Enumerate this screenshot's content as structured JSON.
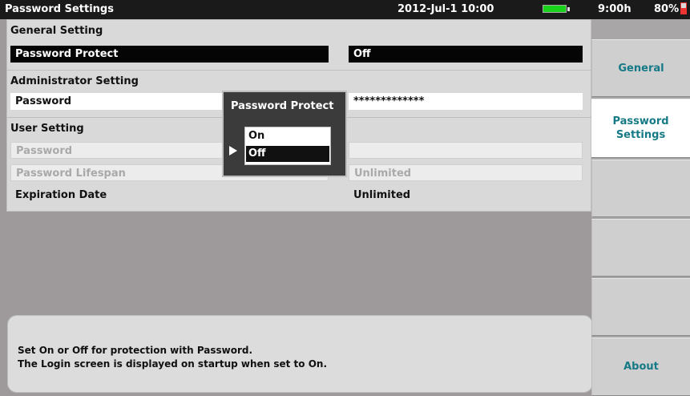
{
  "title_bar": {
    "title": "Password Settings",
    "datetime": "2012-Jul-1 10:00",
    "power_color": "#19d21a"
  },
  "status": {
    "time": "9:00h",
    "battery_percent": "80%"
  },
  "general": {
    "heading": "General Setting",
    "password_protect_label": "Password Protect",
    "password_protect_value": "Off"
  },
  "admin": {
    "heading": "Administrator Setting",
    "password_label": "Password",
    "password_value": "*************"
  },
  "user": {
    "heading": "User Setting",
    "password_label": "Password",
    "password_value": "",
    "lifespan_label": "Password Lifespan",
    "lifespan_value": "Unlimited",
    "expiration_label": "Expiration Date",
    "expiration_value": "Unlimited"
  },
  "popup": {
    "title": "Password Protect",
    "options": [
      "On",
      "Off"
    ],
    "selected": "Off"
  },
  "help": {
    "line1": "Set On or Off for protection with Password.",
    "line2": "The Login screen is displayed on startup when set to On."
  },
  "softkeys": {
    "general": "General",
    "password_settings_line1": "Password",
    "password_settings_line2": "Settings",
    "about": "About",
    "accent_color": "#157a86"
  }
}
